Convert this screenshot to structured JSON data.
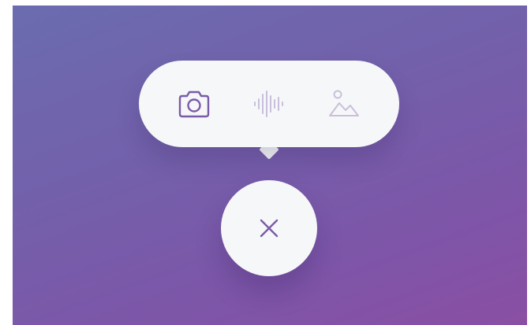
{
  "popover": {
    "items": [
      {
        "icon": "camera-icon",
        "state": "active"
      },
      {
        "icon": "audio-waveform-icon",
        "state": "inactive"
      },
      {
        "icon": "image-icon",
        "state": "inactive"
      }
    ]
  },
  "close_button": {
    "icon": "close-icon"
  },
  "colors": {
    "background_start": "#6b6cb0",
    "background_end": "#8a4fa3",
    "surface": "#f6f7f8",
    "icon_active": "#7a5ba8",
    "icon_inactive": "#c9bfdd"
  }
}
